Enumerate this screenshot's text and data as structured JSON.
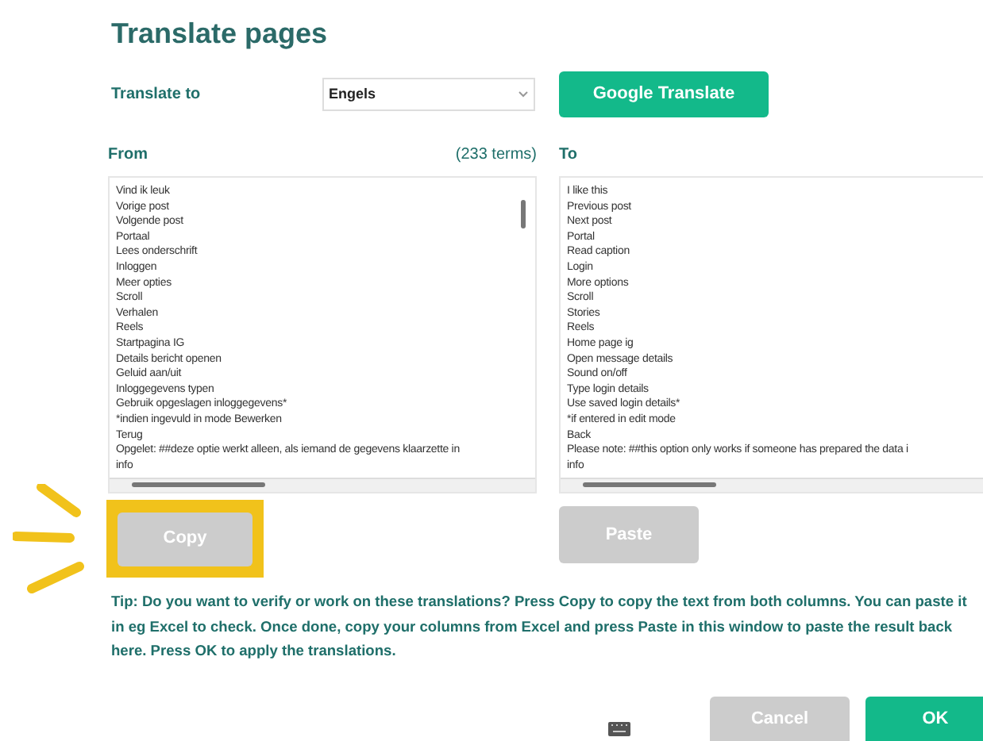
{
  "title": "Translate pages",
  "translate_to": {
    "label": "Translate to",
    "value": "Engels"
  },
  "google_button": {
    "label": "Google Translate",
    "disabled": false
  },
  "from": {
    "label": "From",
    "count": "(233 terms)",
    "lines": [
      "Vind ik leuk",
      "Vorige post",
      "Volgende post",
      "Portaal",
      "Lees onderschrift",
      "Inloggen",
      "Meer opties",
      "Scroll",
      "Verhalen",
      "Reels",
      "Startpagina IG",
      "Details bericht openen",
      "Geluid aan/uit",
      "Inloggegevens typen",
      "Gebruik opgeslagen inloggegevens*",
      "*indien ingevuld in mode Bewerken",
      "Terug",
      "Opgelet: ##deze optie werkt alleen, als iemand de gegevens klaarzette in",
      "info"
    ]
  },
  "to": {
    "label": "To",
    "lines": [
      "I like this",
      "Previous post",
      "Next post",
      "Portal",
      "Read caption",
      "Login",
      "More options",
      "Scroll",
      "Stories",
      "Reels",
      "Home page ig",
      "Open message details",
      "Sound on/off",
      "Type login details",
      "Use saved login details*",
      "*if entered in edit mode",
      "Back",
      "Please note: ##this option only works if someone has prepared the data i",
      "info"
    ]
  },
  "copy_button": {
    "label": "Copy",
    "disabled": true,
    "highlighted": true
  },
  "paste_button": {
    "label": "Paste",
    "disabled": true
  },
  "tip": "Tip: Do you want to verify or work on these translations? Press Copy to copy the text from both columns. You can paste it in eg Excel to check. Once done, copy your columns from Excel and press Paste in this window to paste the result back here. Press OK to apply the translations.",
  "buttons": [
    {
      "label": "Cancel",
      "disabled": true
    },
    {
      "label": "OK",
      "disabled": false
    }
  ]
}
